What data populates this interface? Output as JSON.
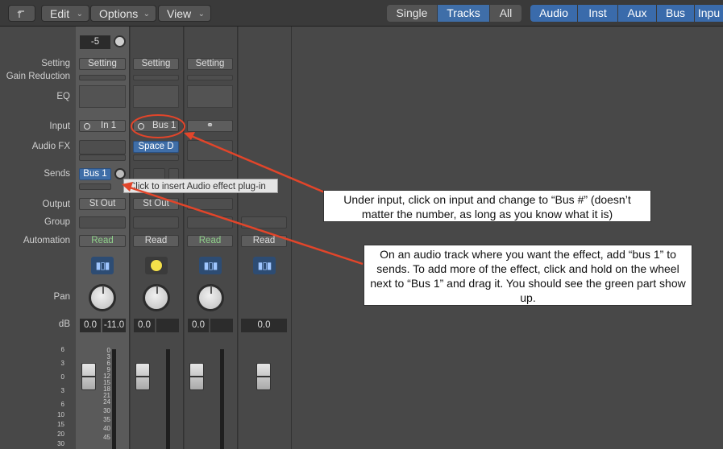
{
  "toolbar": {
    "back_icon": "back-arrow-icon",
    "menus": [
      "Edit",
      "Options",
      "View"
    ],
    "view_modes": [
      "Single",
      "Tracks",
      "All"
    ],
    "selected_view_mode": "Tracks",
    "filters": [
      "Audio",
      "Inst",
      "Aux",
      "Bus",
      "Inpu"
    ]
  },
  "labels": {
    "setting": "Setting",
    "gain_reduction": "Gain Reduction",
    "eq": "EQ",
    "input": "Input",
    "audio_fx": "Audio FX",
    "sends": "Sends",
    "output": "Output",
    "group": "Group",
    "automation": "Automation",
    "pan": "Pan",
    "db": "dB"
  },
  "strip1": {
    "gain_value": "-5",
    "setting": "Setting",
    "input_value": "In 1",
    "send_value": "Bus 1",
    "output": "St Out",
    "automation": "Read",
    "db_volume": "0.0",
    "db_peak": "-11.0"
  },
  "strip2": {
    "setting": "Setting",
    "input_value": "Bus 1",
    "audio_fx": "Space D",
    "output": "St Out",
    "automation": "Read",
    "db_volume": "0.0"
  },
  "strip3": {
    "setting": "Setting",
    "automation": "Read",
    "db_volume": "0.0"
  },
  "strip4": {
    "automation": "Read",
    "db_volume": "0.0"
  },
  "scale_left": [
    "6",
    "3",
    "0",
    "3",
    "6",
    "10",
    "15",
    "20",
    "30"
  ],
  "scale_meter": [
    "0",
    "3",
    "6",
    "9",
    "12",
    "15",
    "18",
    "21",
    "24",
    "30",
    "35",
    "40",
    "45"
  ],
  "tooltip": "Click to insert Audio effect plug-in",
  "callout_input": "Under input, click on input and change to “Bus #” (doesn’t matter the number, as long as you know what it is)",
  "callout_sends": "On an audio track where you want the effect, add “bus 1” to sends. To add more of the effect, click and hold on the wheel next to “Bus 1” and drag it. You should see the green part show up.",
  "colors": {
    "accent_blue": "#3f6ea8",
    "annotation_red": "#e2452a",
    "read_green": "#8fd08a"
  }
}
